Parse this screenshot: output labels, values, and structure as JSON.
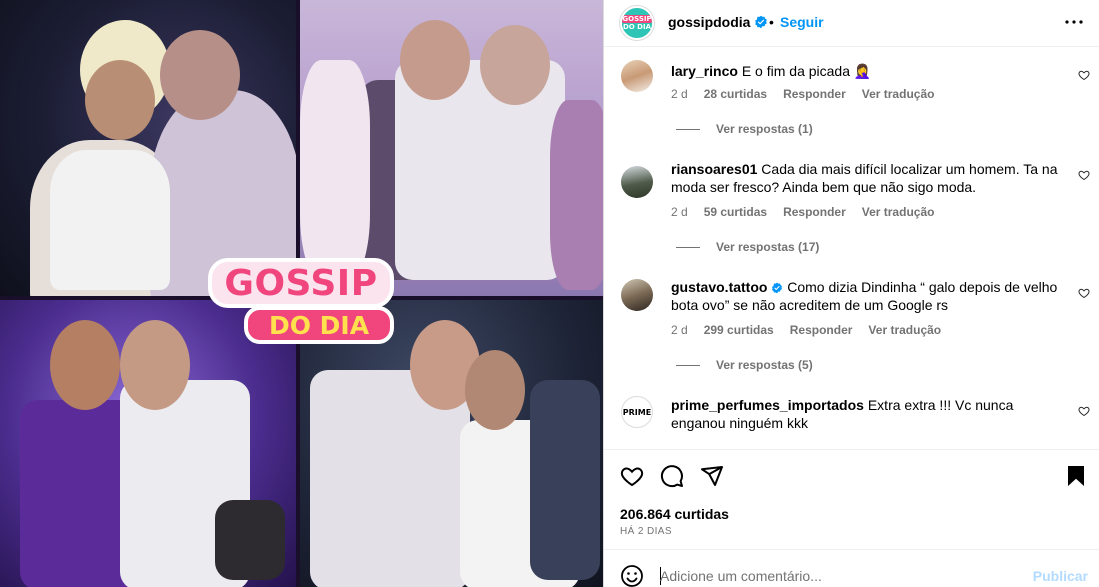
{
  "post": {
    "username": "gossipdodia",
    "dot": "•",
    "follow_label": "Seguir",
    "logo": {
      "line1": "GOSSIP",
      "line2": "DO DIA",
      "avatar_line1": "GOSSIP",
      "avatar_line2": "DO DIA"
    }
  },
  "comments": [
    {
      "username": "lary_rinco",
      "text": "E o fim da picada 🤦‍♀️",
      "time": "2 d",
      "likes": "28 curtidas",
      "reply_label": "Responder",
      "translate_label": "Ver tradução",
      "replies_label": "Ver respostas (1)",
      "verified": false
    },
    {
      "username": "riansoares01",
      "text": "Cada dia mais difícil localizar um homem. Ta na moda ser fresco? Ainda bem que não sigo moda.",
      "time": "2 d",
      "likes": "59 curtidas",
      "reply_label": "Responder",
      "translate_label": "Ver tradução",
      "replies_label": "Ver respostas (17)",
      "verified": false
    },
    {
      "username": "gustavo.tattoo",
      "text": "Como dizia Dindinha “ galo depois de velho bota ovo” se não acreditem de um Google rs",
      "time": "2 d",
      "likes": "299 curtidas",
      "reply_label": "Responder",
      "translate_label": "Ver tradução",
      "replies_label": "Ver respostas (5)",
      "verified": true
    },
    {
      "username": "prime_perfumes_importados",
      "text": "Extra extra !!! Vc nunca enganou ninguém kkk",
      "avatar_text": "PRIME",
      "verified": false
    }
  ],
  "actions": {
    "likes_count": "206.864 curtidas",
    "posted_ago": "HÁ 2 DIAS"
  },
  "composer": {
    "placeholder": "Adicione um comentário...",
    "publish_label": "Publicar"
  },
  "colors": {
    "accent": "#0095f6",
    "muted": "#737373",
    "publish_disabled": "#b3dbff",
    "logo_pink": "#f0457d",
    "logo_yellow": "#ffe14d"
  },
  "icons": [
    "more-options-icon",
    "verified-badge-icon",
    "heart-icon",
    "comment-icon",
    "share-icon",
    "bookmark-icon",
    "emoji-icon"
  ]
}
